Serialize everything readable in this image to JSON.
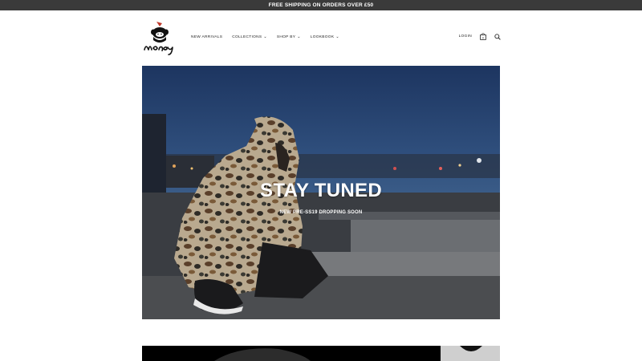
{
  "announcement": {
    "text": "FREE SHIPPING ON ORDERS OVER £50"
  },
  "brand": {
    "logo_icon": "monkey-logo-icon"
  },
  "nav": {
    "items": [
      {
        "label": "NEW ARRIVALS",
        "has_dropdown": false
      },
      {
        "label": "COLLECTIONS",
        "has_dropdown": true
      },
      {
        "label": "SHOP BY",
        "has_dropdown": true
      },
      {
        "label": "LOOKBOOK",
        "has_dropdown": true
      }
    ]
  },
  "tools": {
    "login_label": "LOGIN",
    "cart_count": "0",
    "search_icon": "search-icon",
    "cart_icon": "shopping-bag-icon"
  },
  "hero": {
    "title": "STAY TUNED",
    "subtitle": "NEW PRE-SS19 DROPPING SOON"
  },
  "colors": {
    "announcement_bg": "#3a3a3a",
    "text": "#222222",
    "hero_text": "#ffffff"
  }
}
